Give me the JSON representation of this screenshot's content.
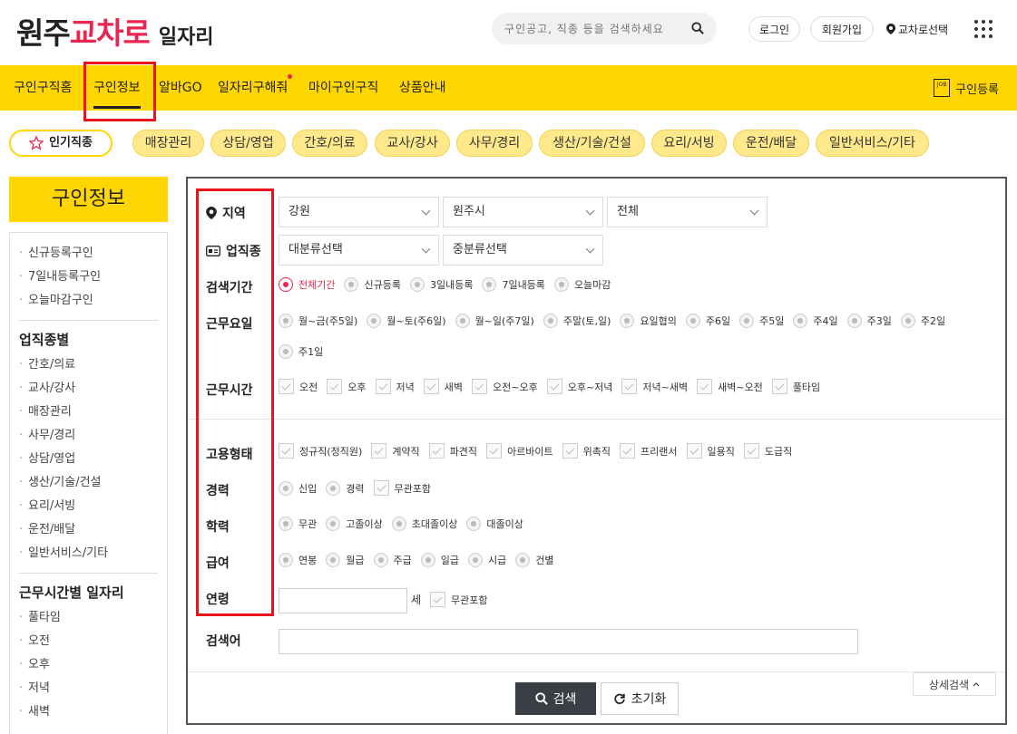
{
  "logo": {
    "part1": "원주",
    "part2": "교차로",
    "part3": "일자리"
  },
  "header": {
    "search_placeholder": "구인공고, 직종 등을 검색하세요",
    "login": "로그인",
    "signup": "회원가입",
    "area_select": "교차로선택"
  },
  "nav": {
    "items": [
      "구인구직홈",
      "구인정보",
      "알바GO",
      "일자리구해줘",
      "마이구인구직",
      "상품안내"
    ],
    "register": "구인등록",
    "job_icon_text": "JOB"
  },
  "chips": {
    "popular": "인기직종",
    "items": [
      "매장관리",
      "상담/영업",
      "간호/의료",
      "교사/강사",
      "사무/경리",
      "생산/기술/건설",
      "요리/서빙",
      "운전/배달",
      "일반서비스/기타"
    ]
  },
  "sidebar": {
    "title": "구인정보",
    "top_links": [
      "신규등록구인",
      "7일내등록구인",
      "오늘마감구인"
    ],
    "section1": "업직종별",
    "section1_links": [
      "간호/의료",
      "교사/강사",
      "매장관리",
      "사무/경리",
      "상담/영업",
      "생산/기술/건설",
      "요리/서빙",
      "운전/배달",
      "일반서비스/기타"
    ],
    "section2": "근무시간별 일자리",
    "section2_links": [
      "풀타임",
      "오전",
      "오후",
      "저녁",
      "새벽"
    ]
  },
  "form": {
    "labels": {
      "region": "지역",
      "job_type": "업직종",
      "period": "검색기간",
      "workdays": "근무요일",
      "worktime": "근무시간",
      "employment": "고용형태",
      "career": "경력",
      "education": "학력",
      "salary": "급여",
      "age": "연령",
      "keyword": "검색어"
    },
    "region_selects": [
      "강원",
      "원주시",
      "전체"
    ],
    "job_selects": [
      "대분류선택",
      "중분류선택"
    ],
    "period_options": [
      "전체기간",
      "신규등록",
      "3일내등록",
      "7일내등록",
      "오늘마감"
    ],
    "period_selected": "전체기간",
    "workday_options": [
      "월~금(주5일)",
      "월~토(주6일)",
      "월~일(주7일)",
      "주말(토,일)",
      "요일협의",
      "주6일",
      "주5일",
      "주4일",
      "주3일",
      "주2일"
    ],
    "workday_options_2": [
      "주1일"
    ],
    "worktime_options": [
      "오전",
      "오후",
      "저녁",
      "새벽",
      "오전~오후",
      "오후~저녁",
      "저녁~새벽",
      "새벽~오전",
      "풀타임"
    ],
    "employment_options": [
      "정규직(정직원)",
      "계약직",
      "파견직",
      "아르바이트",
      "위촉직",
      "프리랜서",
      "일용직",
      "도급직"
    ],
    "career_radios": [
      "신입",
      "경력"
    ],
    "career_check": "무관포함",
    "education_options": [
      "무관",
      "고졸이상",
      "초대졸이상",
      "대졸이상"
    ],
    "salary_options": [
      "연봉",
      "월급",
      "주급",
      "일급",
      "시급",
      "건별"
    ],
    "age_unit": "세",
    "age_check": "무관포함",
    "search_button": "검색",
    "reset_button": "초기화",
    "detail_search": "상세검색"
  },
  "colors": {
    "accent": "#ffd600",
    "brand": "#e8264f",
    "highlight_box": "#e8141b"
  }
}
